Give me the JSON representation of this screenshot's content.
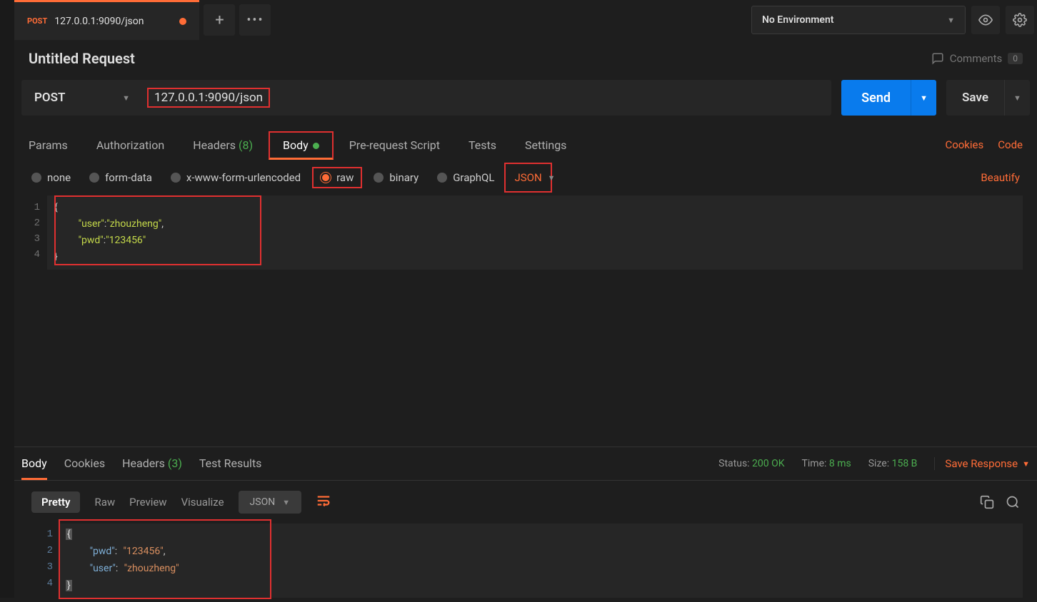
{
  "tab": {
    "method": "POST",
    "title": "127.0.0.1:9090/json"
  },
  "env": {
    "selected": "No Environment"
  },
  "request": {
    "title": "Untitled Request",
    "comments_label": "Comments",
    "comments_count": "0",
    "method": "POST",
    "url": "127.0.0.1:9090/json",
    "send_label": "Send",
    "save_label": "Save"
  },
  "reqTabs": {
    "params": "Params",
    "auth": "Authorization",
    "headers": "Headers",
    "headers_count": "(8)",
    "body": "Body",
    "prescript": "Pre-request Script",
    "tests": "Tests",
    "settings": "Settings",
    "cookies": "Cookies",
    "code": "Code"
  },
  "bodyTypes": {
    "none": "none",
    "formdata": "form-data",
    "urlencoded": "x-www-form-urlencoded",
    "raw": "raw",
    "binary": "binary",
    "graphql": "GraphQL",
    "json": "JSON",
    "beautify": "Beautify"
  },
  "bodyEditor": {
    "line1": "{",
    "line2_key": "\"user\"",
    "line2_val": "\"zhouzheng\"",
    "line3_key": "\"pwd\"",
    "line3_val": "\"123456\"",
    "line4": "}"
  },
  "respTabs": {
    "body": "Body",
    "cookies": "Cookies",
    "headers": "Headers",
    "headers_count": "(3)",
    "tests": "Test Results"
  },
  "stats": {
    "status_label": "Status:",
    "status_val": "200 OK",
    "time_label": "Time:",
    "time_val": "8 ms",
    "size_label": "Size:",
    "size_val": "158 B",
    "save_resp": "Save Response"
  },
  "viewTabs": {
    "pretty": "Pretty",
    "raw": "Raw",
    "preview": "Preview",
    "visualize": "Visualize",
    "json": "JSON"
  },
  "respEditor": {
    "l1": "{",
    "l2_key": "\"pwd\"",
    "l2_val": "\"123456\"",
    "l3_key": "\"user\"",
    "l3_val": "\"zhouzheng\"",
    "l4": "}"
  }
}
